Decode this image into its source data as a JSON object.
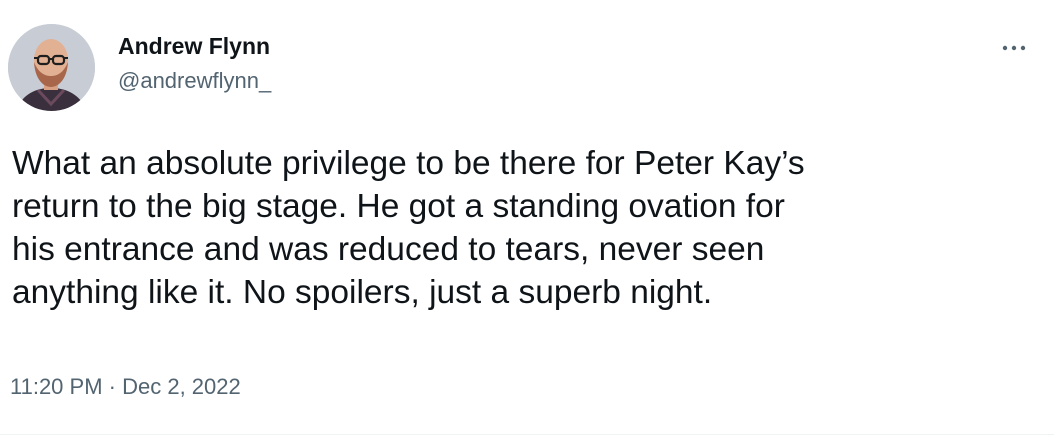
{
  "author": {
    "name": "Andrew Flynn",
    "handle": "@andrewflynn_"
  },
  "tweet": {
    "text": "What an absolute privilege to be there for Peter Kay’s\nreturn to the big stage. He got a standing ovation for\nhis entrance and was reduced to tears, never seen\nanything like it. No spoilers, just a superb night."
  },
  "meta": {
    "time": "11:20 PM",
    "separator": " · ",
    "date": "Dec 2, 2022"
  },
  "icons": {
    "more": "more-horizontal-icon"
  },
  "colors": {
    "text_primary": "#0f1419",
    "text_secondary": "#536471",
    "divider": "#eff3f4"
  }
}
